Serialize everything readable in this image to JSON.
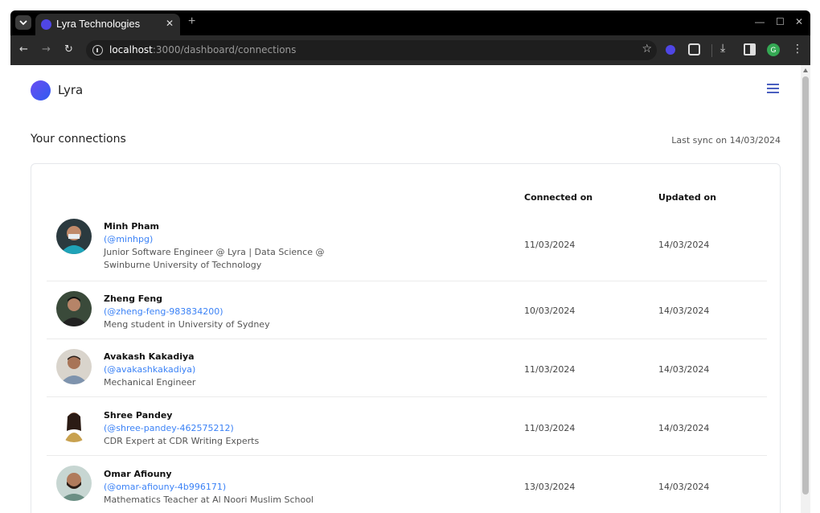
{
  "browser": {
    "tab_title": "Lyra Technologies",
    "url_host": "localhost",
    "url_rest": ":3000/dashboard/connections",
    "profile_initial": "G",
    "colors": {
      "accent": "#4f46e5",
      "profile": "#34a853"
    }
  },
  "app": {
    "brand_name": "Lyra",
    "section_title": "Your connections",
    "last_sync": "Last sync on 14/03/2024"
  },
  "table": {
    "headers": {
      "connected": "Connected on",
      "updated": "Updated on"
    },
    "rows": [
      {
        "name": "Minh Pham",
        "handle": "(@minhpg)",
        "desc": "Junior Software Engineer @ Lyra | Data Science @ Swinburne University of Technology",
        "connected": "11/03/2024",
        "updated": "14/03/2024"
      },
      {
        "name": "Zheng Feng",
        "handle": "(@zheng-feng-983834200)",
        "desc": "Meng student in University of Sydney",
        "connected": "10/03/2024",
        "updated": "14/03/2024"
      },
      {
        "name": "Avakash Kakadiya",
        "handle": "(@avakashkakadiya)",
        "desc": "Mechanical Engineer",
        "connected": "11/03/2024",
        "updated": "14/03/2024"
      },
      {
        "name": "Shree Pandey",
        "handle": "(@shree-pandey-462575212)",
        "desc": "CDR Expert at CDR Writing Experts",
        "connected": "11/03/2024",
        "updated": "14/03/2024"
      },
      {
        "name": "Omar Afiouny",
        "handle": "(@omar-afiouny-4b996171)",
        "desc": "Mathematics Teacher at Al Noori Muslim School",
        "connected": "13/03/2024",
        "updated": "14/03/2024"
      }
    ]
  }
}
